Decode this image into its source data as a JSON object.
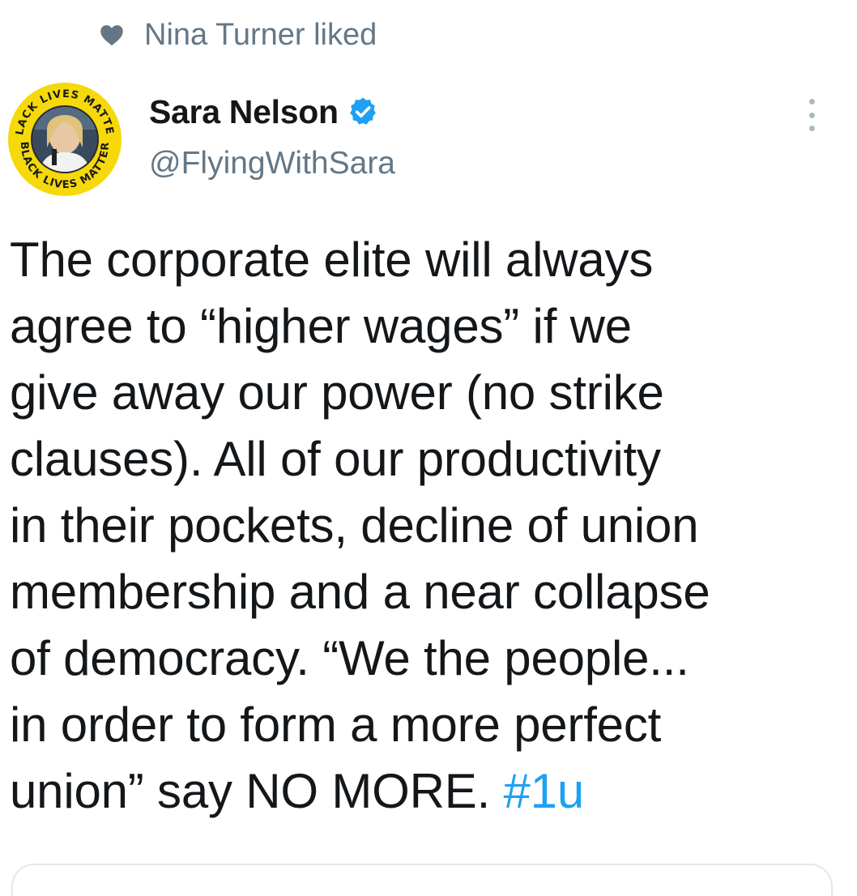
{
  "social_context": {
    "icon": "heart-icon",
    "text": "Nina Turner liked"
  },
  "author": {
    "name": "Sara Nelson",
    "handle": "@FlyingWithSara",
    "verified": true,
    "verified_color": "#1da1f2",
    "avatar_ring_text_top": "BLACK LIVES MATTER",
    "avatar_ring_text_bottom": "BLACK LIVES MATTER",
    "avatar_ring_color": "#f5d90a"
  },
  "menu": {
    "icon": "more-vertical-icon"
  },
  "tweet": {
    "lines": [
      "The corporate elite will always",
      "agree to “higher wages” if we",
      "give away our power (no strike",
      "clauses). All of our productivity",
      "in their pockets, decline of union",
      "membership and a near collapse",
      "of democracy. “We the people...",
      "in order to form a more perfect"
    ],
    "last_line_text": "union” say NO MORE. ",
    "hashtag": "#1u",
    "link_color": "#1da1f2"
  }
}
